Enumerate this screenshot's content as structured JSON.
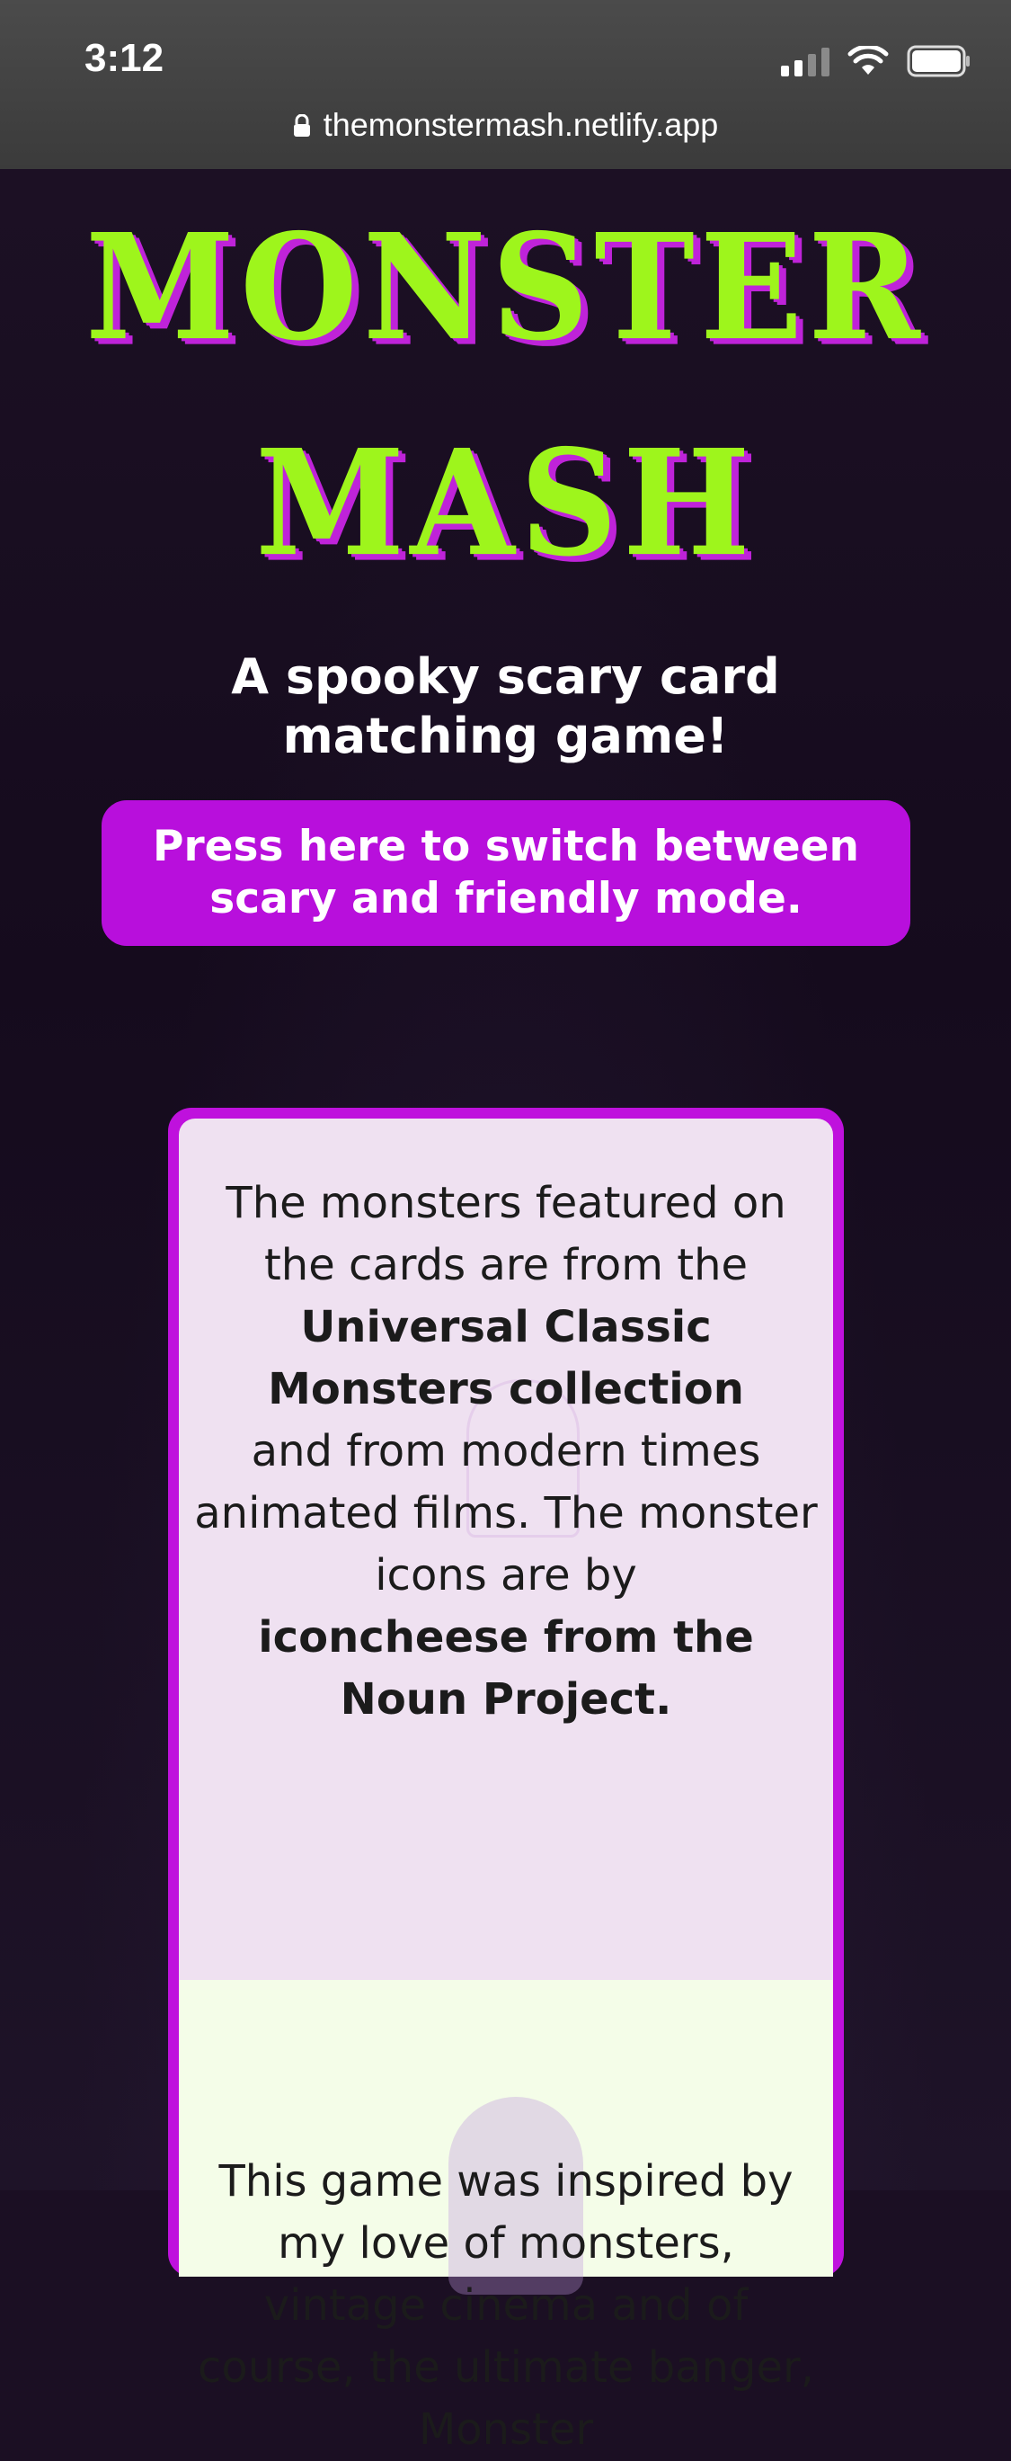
{
  "status_bar": {
    "time": "3:12"
  },
  "browser": {
    "url": "themonstermash.netlify.app"
  },
  "header": {
    "title_line1": "MONSTER",
    "title_line2": "MASH",
    "subtitle": "A spooky scary card matching game!",
    "mode_button": "Press here to switch between scary and friendly mode."
  },
  "card": {
    "front": {
      "p1": "The monsters featured on the cards are from the",
      "b1": "Universal Classic Monsters collection",
      "p2": "and from modern times animated films. The monster icons are by",
      "b2": "iconcheese from the Noun Project."
    },
    "back": {
      "p1": "This game was inspired by my love of monsters, vintage cinema and of course, the ultimate banger, Monster"
    }
  },
  "colors": {
    "title_green": "#9ef51c",
    "accent_purple": "#b80fdc",
    "background": "#1b0f23"
  }
}
